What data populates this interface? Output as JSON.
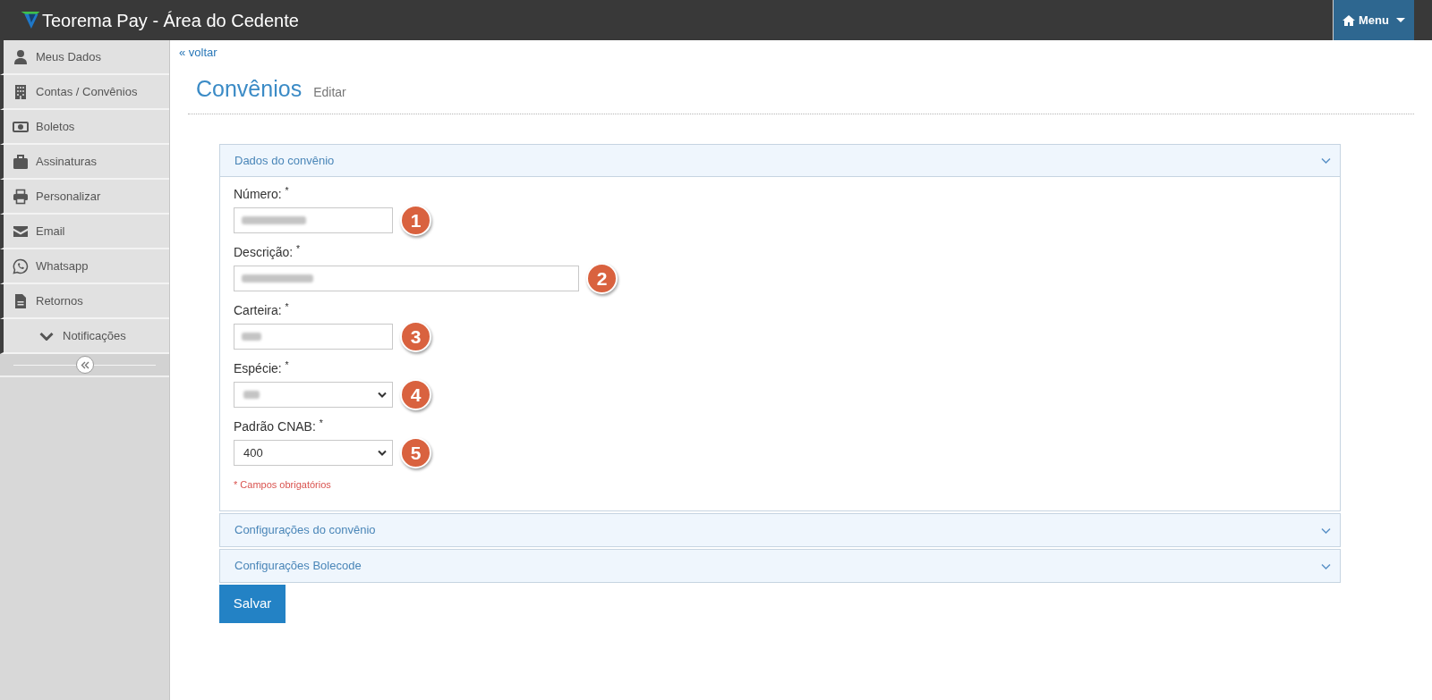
{
  "header": {
    "title": "Teorema Pay - Área do Cedente",
    "menu_button": {
      "label": "Menu"
    }
  },
  "sidebar": {
    "items": [
      {
        "label": "Meus Dados",
        "kind": "link"
      },
      {
        "label": "Contas / Convênios",
        "kind": "link"
      },
      {
        "label": "Boletos",
        "kind": "link"
      },
      {
        "label": "Assinaturas",
        "kind": "link"
      },
      {
        "label": "Personalizar",
        "kind": "link"
      },
      {
        "label": "Email",
        "kind": "link"
      },
      {
        "label": "Whatsapp",
        "kind": "link"
      },
      {
        "label": "Retornos",
        "kind": "link"
      },
      {
        "label": "Notificações",
        "kind": "group"
      }
    ]
  },
  "back_link": "« voltar",
  "page_header": {
    "title": "Convênios",
    "subtitle": "Editar"
  },
  "panels": [
    {
      "title": "Dados do convênio",
      "expanded": true,
      "fields": [
        {
          "label": "Número: $^{*}$",
          "kind": "short",
          "redacted": true,
          "marker": "1"
        },
        {
          "label": "Descrição: $^{*}$",
          "kind": "long",
          "redacted": true,
          "marker": "2"
        },
        {
          "label": "Carteira: $^{*}$",
          "kind": "short",
          "redacted": true,
          "marker": "3"
        },
        {
          "label": "Espécie: $^{*}$",
          "kind": "select",
          "redacted": true,
          "marker": "4"
        },
        {
          "label": "Padrão CNAB: $^{*}$",
          "kind": "select",
          "value": "400",
          "redacted": false,
          "marker": "5"
        }
      ],
      "note": "* Campos obrigatórios"
    },
    {
      "title": "Configurações do convênio",
      "expanded": false
    },
    {
      "title": "Configurações Bolecode",
      "expanded": false
    }
  ],
  "save_button": "Salvar"
}
